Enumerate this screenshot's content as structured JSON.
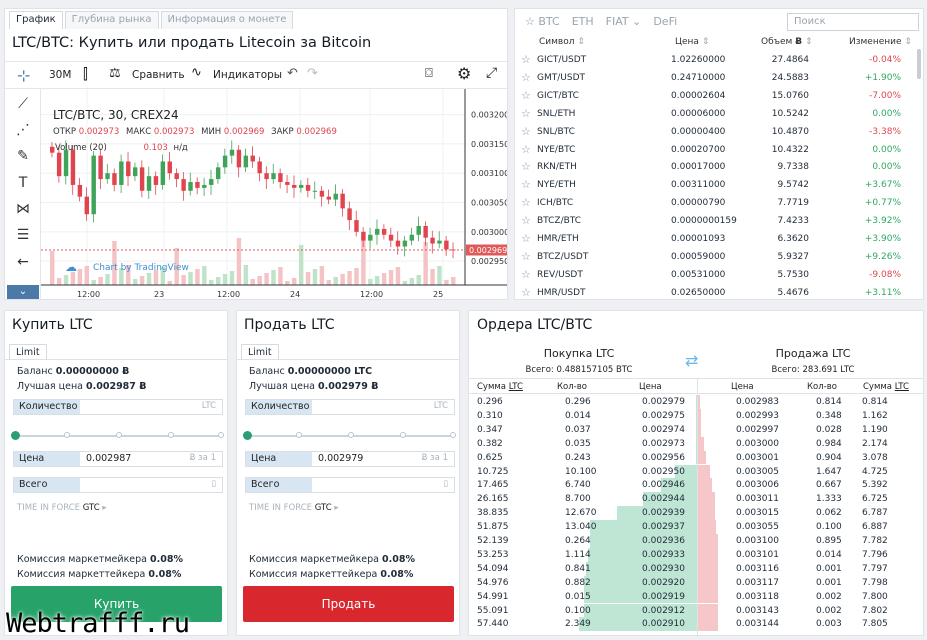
{
  "chart_panel": {
    "tabs": [
      "График",
      "Глубина рынка",
      "Информация о монете"
    ],
    "title": "LTC/BTC: Купить или продать Litecoin за Bitcoin",
    "toolbar": {
      "interval": "30M",
      "compare": "Сравнить",
      "indicators": "Индикаторы"
    },
    "legend": {
      "symbol": "LTC/BTC, 30, CREX24",
      "open_label": "ОТКР",
      "open": "0.002973",
      "high_label": "МАКС",
      "high": "0.002973",
      "low_label": "МИН",
      "low": "0.002969",
      "close_label": "ЗАКР",
      "close": "0.002969",
      "volume_label": "Volume (20)",
      "volume_value": "0.103",
      "volume_na": "н/д"
    },
    "attribution": "Chart by TradingView",
    "last_price": "0.002969"
  },
  "chart_data": {
    "type": "candlestick",
    "x_ticks": [
      "12:00",
      "23",
      "12:00",
      "24",
      "12:00",
      "25"
    ],
    "y_ticks": [
      "0.003200",
      "0.003150",
      "0.003100",
      "0.003050",
      "0.003000",
      "0.002950"
    ],
    "ylim": [
      0.00294,
      0.00323
    ],
    "close_series": [
      0.003135,
      0.003095,
      0.00314,
      0.00308,
      0.00306,
      0.00303,
      0.00313,
      0.00309,
      0.0031,
      0.00308,
      0.00312,
      0.003095,
      0.00311,
      0.00307,
      0.003095,
      0.00308,
      0.00312,
      0.0031,
      0.00309,
      0.00307,
      0.003085,
      0.003075,
      0.00308,
      0.00309,
      0.00311,
      0.00313,
      0.00314,
      0.00311,
      0.00313,
      0.00312,
      0.0031,
      0.00309,
      0.0031,
      0.003085,
      0.00308,
      0.003075,
      0.00308,
      0.00307,
      0.00307,
      0.00306,
      0.003055,
      0.003065,
      0.00304,
      0.00302,
      0.003,
      0.002985,
      0.002995,
      0.003005,
      0.002995,
      0.002985,
      0.002975,
      0.002985,
      0.002995,
      0.00301,
      0.00299,
      0.00298,
      0.002985,
      0.00297,
      0.002969
    ],
    "grid": true
  },
  "markets": {
    "tabs": [
      "BTC",
      "ETH",
      "FIAT",
      "DeFi"
    ],
    "search_placeholder": "Поиск",
    "headers": {
      "symbol": "Символ",
      "price": "Цена",
      "volume": "Объем",
      "volume_unit": "Ƀ",
      "change": "Изменение"
    },
    "rows": [
      {
        "symbol": "GICT/USDT",
        "price": "1.02260000",
        "volume": "27.4864",
        "change": "-0.04%"
      },
      {
        "symbol": "GMT/USDT",
        "price": "0.24710000",
        "volume": "24.5883",
        "change": "+1.90%"
      },
      {
        "symbol": "GICT/BTC",
        "price": "0.00002604",
        "volume": "15.0760",
        "change": "-7.00%"
      },
      {
        "symbol": "SNL/ETH",
        "price": "0.00006000",
        "volume": "10.5242",
        "change": "0.00%"
      },
      {
        "symbol": "SNL/BTC",
        "price": "0.00000400",
        "volume": "10.4870",
        "change": "-3.38%"
      },
      {
        "symbol": "NYE/BTC",
        "price": "0.00020700",
        "volume": "10.4322",
        "change": "0.00%"
      },
      {
        "symbol": "RKN/ETH",
        "price": "0.00017000",
        "volume": "9.7338",
        "change": "0.00%"
      },
      {
        "symbol": "NYE/ETH",
        "price": "0.00311000",
        "volume": "9.5742",
        "change": "+3.67%"
      },
      {
        "symbol": "ICH/BTC",
        "price": "0.00000790",
        "volume": "7.7719",
        "change": "+0.77%"
      },
      {
        "symbol": "BTCZ/BTC",
        "price": "0.0000000159",
        "volume": "7.4233",
        "change": "+3.92%"
      },
      {
        "symbol": "HMR/ETH",
        "price": "0.00001093",
        "volume": "6.3620",
        "change": "+3.90%"
      },
      {
        "symbol": "BTCZ/USDT",
        "price": "0.00059000",
        "volume": "5.9327",
        "change": "+9.26%"
      },
      {
        "symbol": "REV/USDT",
        "price": "0.00531000",
        "volume": "5.7530",
        "change": "-9.08%"
      },
      {
        "symbol": "HMR/USDT",
        "price": "0.02650000",
        "volume": "5.4676",
        "change": "+3.11%"
      }
    ]
  },
  "buy": {
    "title": "Купить LTC",
    "tab": "Limit",
    "balance_label": "Баланс",
    "balance": "0.00000000 Ƀ",
    "best_label": "Лучшая цена",
    "best": "0.002987 Ƀ",
    "qty_label": "Количество",
    "qty_unit": "LTC",
    "price_label": "Цена",
    "price": "0.002987",
    "price_unit": "Ƀ за 1",
    "total_label": "Всего",
    "tif_label": "TIME IN FORCE",
    "tif": "GTC",
    "maker_label": "Комиссия маркетмейкера",
    "maker": "0.08%",
    "taker_label": "Комиссия маркеттейкера",
    "taker": "0.08%",
    "button": "Купить",
    "color": "#27a36a"
  },
  "sell": {
    "title": "Продать LTC",
    "tab": "Limit",
    "balance_label": "Баланс",
    "balance": "0.00000000 LTC",
    "best_label": "Лучшая цена",
    "best": "0.002979 Ƀ",
    "qty_label": "Количество",
    "qty_unit": "LTC",
    "price_label": "Цена",
    "price": "0.002979",
    "price_unit": "Ƀ за 1",
    "total_label": "Всего",
    "tif_label": "TIME IN FORCE",
    "tif": "GTC",
    "maker_label": "Комиссия маркетмейкера",
    "maker": "0.08%",
    "taker_label": "Комиссия маркеттейкера",
    "taker": "0.08%",
    "button": "Продать",
    "color": "#d9272e"
  },
  "orders": {
    "title": "Ордера LTC/BTC",
    "buy_title": "Покупка LTC",
    "buy_total": "Всего: 0.488157105 BTC",
    "sell_title": "Продажа LTC",
    "sell_total": "Всего: 283.691 LTC",
    "headers": {
      "sum": "Сумма",
      "sum_unit": "LTC",
      "qty": "Кол-во",
      "price": "Цена"
    },
    "bids": [
      [
        "0.296",
        "0.296",
        "0.002979"
      ],
      [
        "0.310",
        "0.014",
        "0.002975"
      ],
      [
        "0.347",
        "0.037",
        "0.002974"
      ],
      [
        "0.382",
        "0.035",
        "0.002973"
      ],
      [
        "0.625",
        "0.243",
        "0.002956"
      ],
      [
        "10.725",
        "10.100",
        "0.002950"
      ],
      [
        "17.465",
        "6.740",
        "0.002946"
      ],
      [
        "26.165",
        "8.700",
        "0.002944"
      ],
      [
        "38.835",
        "12.670",
        "0.002939"
      ],
      [
        "51.875",
        "13.040",
        "0.002937"
      ],
      [
        "52.139",
        "0.264",
        "0.002936"
      ],
      [
        "53.253",
        "1.114",
        "0.002933"
      ],
      [
        "54.094",
        "0.841",
        "0.002930"
      ],
      [
        "54.976",
        "0.882",
        "0.002920"
      ],
      [
        "54.991",
        "0.015",
        "0.002919"
      ],
      [
        "55.091",
        "0.100",
        "0.002912"
      ],
      [
        "57.440",
        "2.349",
        "0.002910"
      ]
    ],
    "asks": [
      [
        "0.002983",
        "0.814",
        "0.814"
      ],
      [
        "0.002993",
        "0.348",
        "1.162"
      ],
      [
        "0.002997",
        "0.028",
        "1.190"
      ],
      [
        "0.003000",
        "0.984",
        "2.174"
      ],
      [
        "0.003001",
        "0.904",
        "3.078"
      ],
      [
        "0.003005",
        "1.647",
        "4.725"
      ],
      [
        "0.003006",
        "0.667",
        "5.392"
      ],
      [
        "0.003011",
        "1.333",
        "6.725"
      ],
      [
        "0.003015",
        "0.062",
        "6.787"
      ],
      [
        "0.003055",
        "0.100",
        "6.887"
      ],
      [
        "0.003100",
        "0.895",
        "7.782"
      ],
      [
        "0.003101",
        "0.014",
        "7.796"
      ],
      [
        "0.003116",
        "0.001",
        "7.797"
      ],
      [
        "0.003117",
        "0.001",
        "7.798"
      ],
      [
        "0.003118",
        "0.002",
        "7.800"
      ],
      [
        "0.003143",
        "0.002",
        "7.802"
      ],
      [
        "0.003144",
        "0.003",
        "7.805"
      ]
    ]
  },
  "watermark": "Webtrafff.ru"
}
